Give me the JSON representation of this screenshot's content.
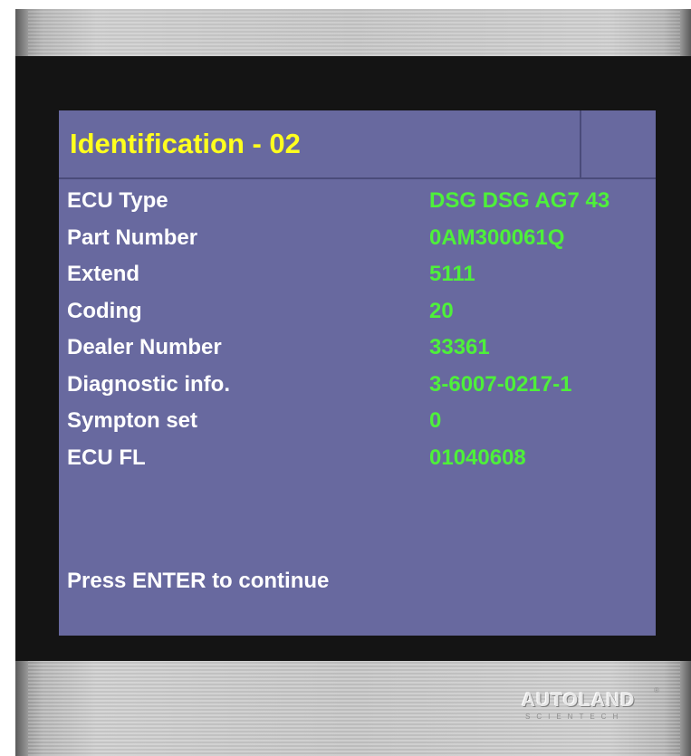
{
  "screen": {
    "title": "Identification - 02",
    "rows": [
      {
        "label": "ECU Type",
        "value": "DSG DSG AG7 43"
      },
      {
        "label": "Part Number",
        "value": "0AM300061Q"
      },
      {
        "label": "Extend",
        "value": "5111"
      },
      {
        "label": "Coding",
        "value": "20"
      },
      {
        "label": "Dealer Number",
        "value": "33361"
      },
      {
        "label": "Diagnostic info.",
        "value": "3-6007-0217-1"
      },
      {
        "label": "Sympton set",
        "value": "0"
      },
      {
        "label": "ECU FL",
        "value": "01040608"
      }
    ],
    "prompt": "Press ENTER to continue"
  },
  "brand": {
    "logo_text": "AUTOLAND",
    "logo_subtext": "SCIENTECH",
    "trademark": "®"
  },
  "colors": {
    "screen_bg": "#68699f",
    "title": "#ffff1e",
    "label": "#ffffff",
    "value": "#4ef03a"
  }
}
